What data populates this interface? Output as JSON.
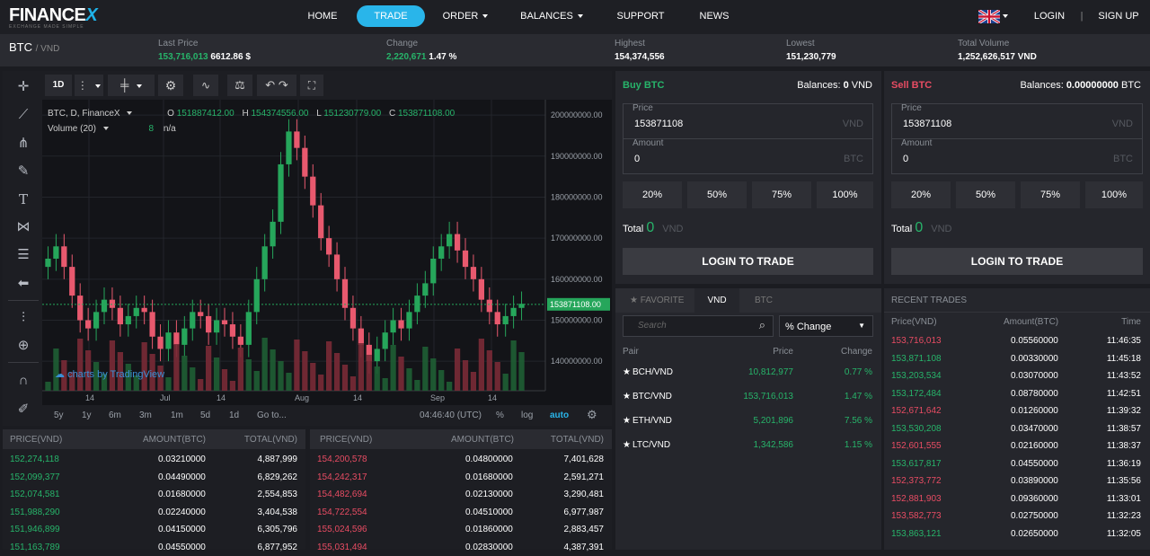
{
  "brand": {
    "logo_main": "FINANCE",
    "logo_x": "X",
    "tagline": "EXCHANGE MADE SIMPLE"
  },
  "nav": {
    "items": [
      {
        "label": "HOME"
      },
      {
        "label": "TRADE"
      },
      {
        "label": "ORDER"
      },
      {
        "label": "BALANCES"
      },
      {
        "label": "SUPPORT"
      },
      {
        "label": "NEWS"
      }
    ],
    "login": "LOGIN",
    "separator": "|",
    "signup": "SIGN UP"
  },
  "ticker": {
    "pair": "BTC",
    "quote": "/ VND",
    "last_label": "Last Price",
    "last_vnd": "153,716,013",
    "last_usd": "6612.86 $",
    "change_label": "Change",
    "change_value": "2,220,671",
    "change_pct": "1.47 %",
    "high_label": "Highest",
    "high": "154,374,556",
    "low_label": "Lowest",
    "low": "151,230,779",
    "vol_label": "Total Volume",
    "vol": "1,252,626,517 VND"
  },
  "chart_toolbar": {
    "interval": "1D"
  },
  "chart_legend": {
    "symbol": "BTC, D, FinanceX",
    "o_label": "O",
    "o": "151887412.00",
    "h_label": "H",
    "h": "154374556.00",
    "l_label": "L",
    "l": "151230779.00",
    "c_label": "C",
    "c": "153871108.00",
    "volume": "Volume (20)",
    "vol_val": "8",
    "vol_na": "n/a"
  },
  "chart_data": {
    "type": "line",
    "y_ticks": [
      "200000000.00",
      "190000000.00",
      "180000000.00",
      "170000000.00",
      "160000000.00",
      "150000000.00",
      "140000000.00"
    ],
    "x_ticks": [
      "14",
      "Jul",
      "14",
      "Aug",
      "14",
      "Sep",
      "14"
    ],
    "current_price_label": "153871108.00",
    "watermark": "charts by TradingView",
    "close_series_approx": [
      165,
      168,
      163,
      156,
      150,
      148,
      152,
      155,
      153,
      149,
      151,
      153,
      152,
      146,
      143,
      147,
      144,
      148,
      152,
      151,
      147,
      150,
      149,
      146,
      144,
      152,
      160,
      168,
      174,
      188,
      196,
      192,
      185,
      178,
      170,
      166,
      160,
      153,
      148,
      144,
      140,
      143,
      147,
      150,
      148,
      152,
      156,
      159,
      165,
      168,
      171,
      167,
      163,
      160,
      155,
      152,
      149,
      151,
      153,
      154
    ],
    "ylim": [
      135000000,
      202000000
    ]
  },
  "chart_bottom": {
    "ranges": [
      "5y",
      "1y",
      "6m",
      "3m",
      "1m",
      "5d",
      "1d"
    ],
    "goto": "Go to...",
    "time": "04:46:40 (UTC)",
    "pct": "%",
    "log": "log",
    "auto": "auto"
  },
  "buy": {
    "title": "Buy BTC",
    "balance_label": "Balances:",
    "balance": "0",
    "balance_unit": "VND",
    "price_label": "Price",
    "price": "153871108",
    "price_unit": "VND",
    "amount_label": "Amount",
    "amount": "0",
    "amount_unit": "BTC",
    "pcts": [
      "20%",
      "50%",
      "75%",
      "100%"
    ],
    "total_label": "Total",
    "total": "0",
    "total_unit": "VND",
    "button": "LOGIN TO TRADE"
  },
  "sell": {
    "title": "Sell BTC",
    "balance_label": "Balances:",
    "balance": "0.00000000",
    "balance_unit": "BTC",
    "price_label": "Price",
    "price": "153871108",
    "price_unit": "VND",
    "amount_label": "Amount",
    "amount": "0",
    "amount_unit": "BTC",
    "pcts": [
      "20%",
      "50%",
      "75%",
      "100%"
    ],
    "total_label": "Total",
    "total": "0",
    "total_unit": "VND",
    "button": "LOGIN TO TRADE"
  },
  "buy_orders": {
    "headers": [
      "PRICE(VND)",
      "AMOUNT(BTC)",
      "TOTAL(VND)"
    ],
    "rows": [
      [
        "152,274,118",
        "0.03210000",
        "4,887,999"
      ],
      [
        "152,099,377",
        "0.04490000",
        "6,829,262"
      ],
      [
        "152,074,581",
        "0.01680000",
        "2,554,853"
      ],
      [
        "151,988,290",
        "0.02240000",
        "3,404,538"
      ],
      [
        "151,946,899",
        "0.04150000",
        "6,305,796"
      ],
      [
        "151,163,789",
        "0.04550000",
        "6,877,952"
      ]
    ]
  },
  "sell_orders": {
    "headers": [
      "PRICE(VND)",
      "AMOUNT(BTC)",
      "TOTAL(VND)"
    ],
    "rows": [
      [
        "154,200,578",
        "0.04800000",
        "7,401,628"
      ],
      [
        "154,242,317",
        "0.01680000",
        "2,591,271"
      ],
      [
        "154,482,694",
        "0.02130000",
        "3,290,481"
      ],
      [
        "154,722,554",
        "0.04510000",
        "6,977,987"
      ],
      [
        "155,024,596",
        "0.01860000",
        "2,883,457"
      ],
      [
        "155,031,494",
        "0.02830000",
        "4,387,391"
      ]
    ]
  },
  "markets": {
    "tabs": [
      "FAVORITE",
      "VND",
      "BTC"
    ],
    "search_placeholder": "Search",
    "sort_select": "% Change",
    "headers": [
      "Pair",
      "Price",
      "Change"
    ],
    "rows": [
      [
        "BCH/VND",
        "10,812,977",
        "0.77 %"
      ],
      [
        "BTC/VND",
        "153,716,013",
        "1.47 %"
      ],
      [
        "ETH/VND",
        "5,201,896",
        "7.56 %"
      ],
      [
        "LTC/VND",
        "1,342,586",
        "1.15 %"
      ]
    ]
  },
  "recent": {
    "title": "RECENT TRADES",
    "headers": [
      "Price(VND)",
      "Amount(BTC)",
      "Time"
    ],
    "rows": [
      [
        "153,716,013",
        "0.05560000",
        "11:46:35",
        "red"
      ],
      [
        "153,871,108",
        "0.00330000",
        "11:45:18",
        "green"
      ],
      [
        "153,203,534",
        "0.03070000",
        "11:43:52",
        "green"
      ],
      [
        "153,172,484",
        "0.08780000",
        "11:42:51",
        "green"
      ],
      [
        "152,671,642",
        "0.01260000",
        "11:39:32",
        "red"
      ],
      [
        "153,530,208",
        "0.03470000",
        "11:38:57",
        "green"
      ],
      [
        "152,601,555",
        "0.02160000",
        "11:38:37",
        "red"
      ],
      [
        "153,617,817",
        "0.04550000",
        "11:36:19",
        "green"
      ],
      [
        "152,373,772",
        "0.03890000",
        "11:35:56",
        "red"
      ],
      [
        "152,881,903",
        "0.09360000",
        "11:33:01",
        "red"
      ],
      [
        "153,582,773",
        "0.02750000",
        "11:32:23",
        "red"
      ],
      [
        "153,863,121",
        "0.02650000",
        "11:32:05",
        "green"
      ]
    ]
  },
  "colors": {
    "accent": "#29b5ea",
    "green": "#27b46a",
    "red": "#e84c63"
  }
}
